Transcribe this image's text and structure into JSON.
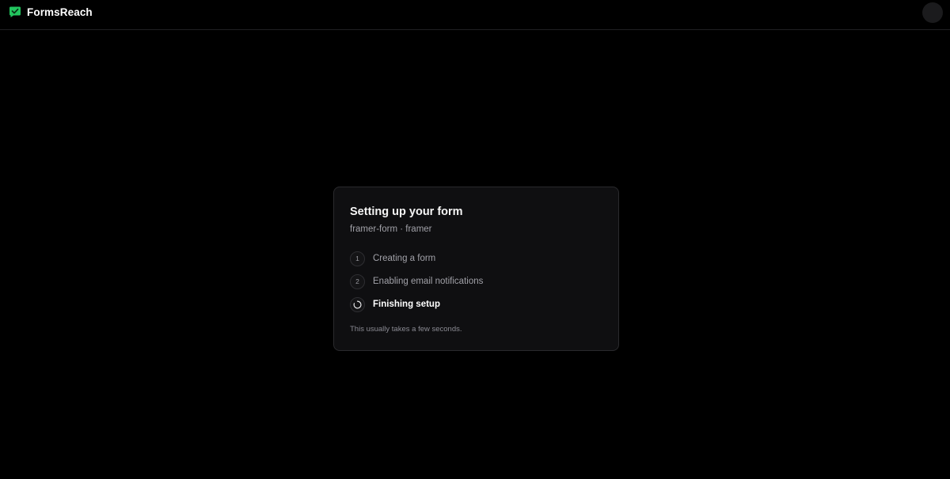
{
  "app": {
    "name": "FormsReach",
    "logo_icon": "check-badge-icon",
    "accent": "#22c55e"
  },
  "setup": {
    "title": "Setting up your form",
    "subtitle": "framer-form · framer",
    "steps": [
      {
        "number": "1",
        "label": "Creating a form",
        "status": "done"
      },
      {
        "number": "2",
        "label": "Enabling email notifications",
        "status": "done"
      },
      {
        "number": "",
        "label": "Finishing setup",
        "status": "in-progress",
        "icon": "spinner-icon"
      }
    ],
    "note": "This usually takes a few seconds."
  }
}
